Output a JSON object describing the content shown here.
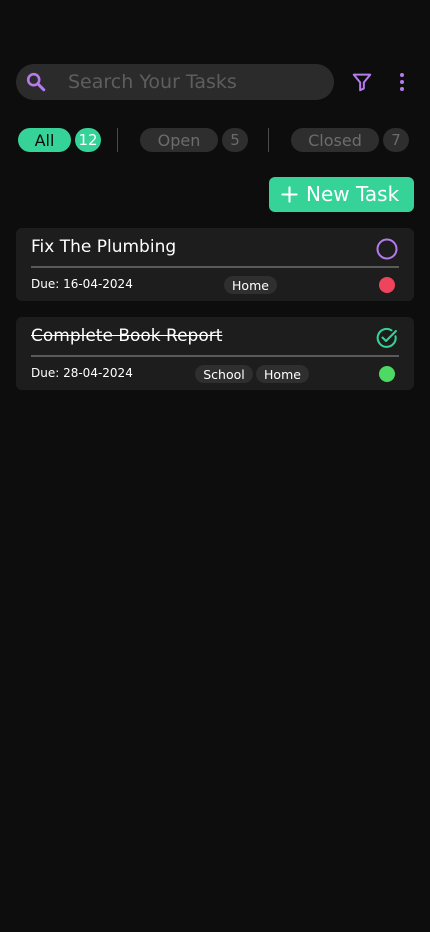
{
  "search": {
    "placeholder": "Search Your Tasks",
    "value": ""
  },
  "toolbar": {
    "filter_icon": "filter-icon",
    "more_icon": "more-vertical-icon"
  },
  "tabs": [
    {
      "label": "All",
      "count": "12",
      "active": true
    },
    {
      "label": "Open",
      "count": "5",
      "active": false
    },
    {
      "label": "Closed",
      "count": "7",
      "active": false
    }
  ],
  "new_task": {
    "label": "New Task",
    "icon": "plus-icon"
  },
  "tasks": [
    {
      "title": "Fix The Plumbing",
      "due": "Due: 16-04-2024",
      "tags": [
        "Home"
      ],
      "completed": false,
      "priority_color": "#f0445c"
    },
    {
      "title": "Complete Book Report",
      "due": "Due: 28-04-2024",
      "tags": [
        "School",
        "Home"
      ],
      "completed": true,
      "priority_color": "#4cd964"
    }
  ],
  "colors": {
    "accent": "#36d399",
    "icon_purple": "#b57bee",
    "background": "#0d0d0d",
    "card": "#1d1d1d"
  }
}
